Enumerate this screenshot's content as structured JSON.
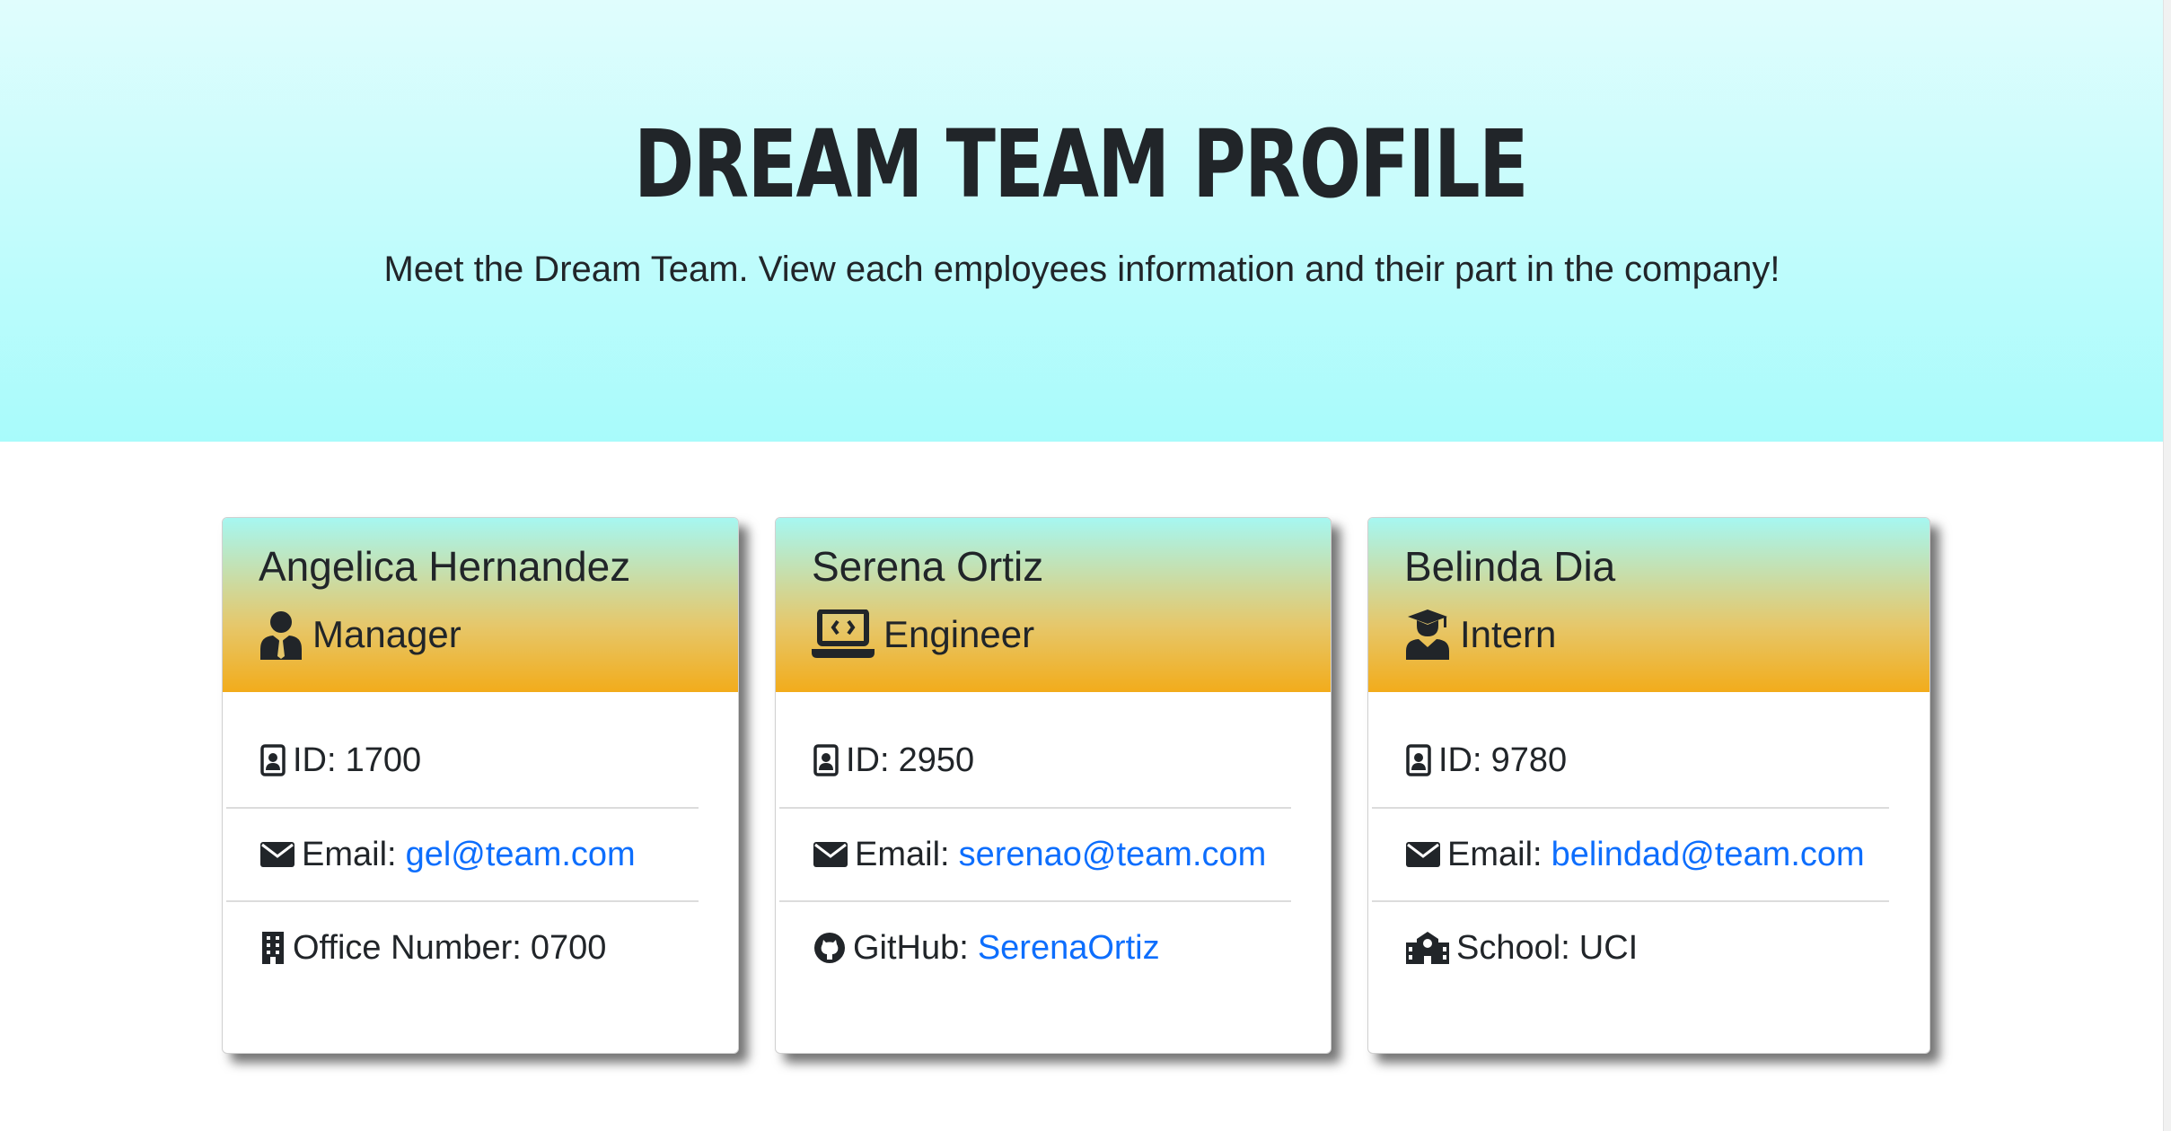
{
  "header": {
    "title": "Dream Team Profile",
    "subtitle": "Meet the Dream Team. View each employees information and their part in the company!"
  },
  "colors": {
    "hero_top": "#e0fdfd",
    "hero_bottom": "#a8fbfb",
    "card_header_top": "#a6f7f1",
    "card_header_bottom": "#f2ac1b",
    "link": "#0d6efd"
  },
  "cards": [
    {
      "name": "Angelica Hernandez",
      "role": "Manager",
      "role_icon": "manager-icon",
      "id_label": "ID:",
      "id": "1700",
      "email_label": "Email:",
      "email": "gel@team.com",
      "extra_icon": "building-icon",
      "extra_label": "Office Number:",
      "extra_value": "0700"
    },
    {
      "name": "Serena Ortiz",
      "role": "Engineer",
      "role_icon": "laptop-code-icon",
      "id_label": "ID:",
      "id": "2950",
      "email_label": "Email:",
      "email": "serenao@team.com",
      "extra_icon": "github-icon",
      "extra_label": "GitHub:",
      "extra_value": "SerenaOrtiz"
    },
    {
      "name": "Belinda Dia",
      "role": "Intern",
      "role_icon": "graduate-icon",
      "id_label": "ID:",
      "id": "9780",
      "email_label": "Email:",
      "email": "belindad@team.com",
      "extra_icon": "school-icon",
      "extra_label": "School:",
      "extra_value": "UCI"
    }
  ]
}
